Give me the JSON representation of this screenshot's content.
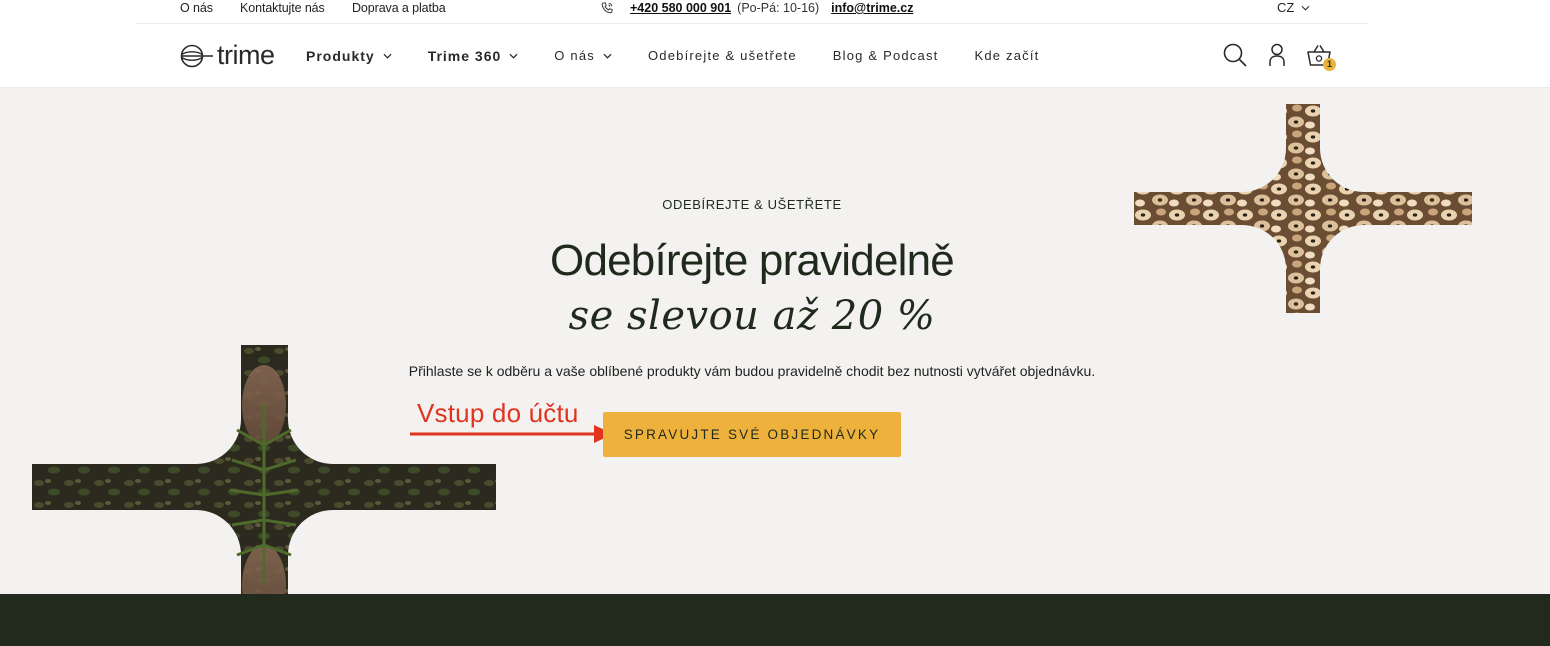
{
  "topbar": {
    "links": [
      "O nás",
      "Kontaktujte nás",
      "Doprava a platba"
    ],
    "phone": "+420 580 000 901",
    "hours": "(Po-Pá: 10-16)",
    "email": "info@trime.cz",
    "language": "CZ"
  },
  "header": {
    "logo_text": "trime",
    "nav": [
      {
        "label": "Produkty",
        "dropdown": true
      },
      {
        "label": "Trime 360",
        "dropdown": true
      },
      {
        "label": "O nás",
        "dropdown": true
      },
      {
        "label": "Odebírejte & ušetřete",
        "dropdown": false
      },
      {
        "label": "Blog & Podcast",
        "dropdown": false
      },
      {
        "label": "Kde začít",
        "dropdown": false
      }
    ],
    "icons": [
      "search-icon",
      "account-icon",
      "cart-icon"
    ],
    "cart_count": "1"
  },
  "hero": {
    "eyebrow": "ODEBÍREJTE & UŠETŘETE",
    "title": "Odebírejte pravidelně",
    "subtitle": "se slevou až 20 %",
    "description": "Přihlaste se k odběru a vaše oblíbené produkty vám budou pravidelně chodit bez nutnosti vytvářet objednávku.",
    "cta_label": "SPRAVUJTE SVÉ OBJEDNÁVKY",
    "annotation": "Vstup do účtu"
  },
  "colors": {
    "accent": "#eeb23c",
    "dark_green": "#212a1d",
    "hero_bg": "#f3f2f0",
    "annotation_red": "#e2331f"
  }
}
